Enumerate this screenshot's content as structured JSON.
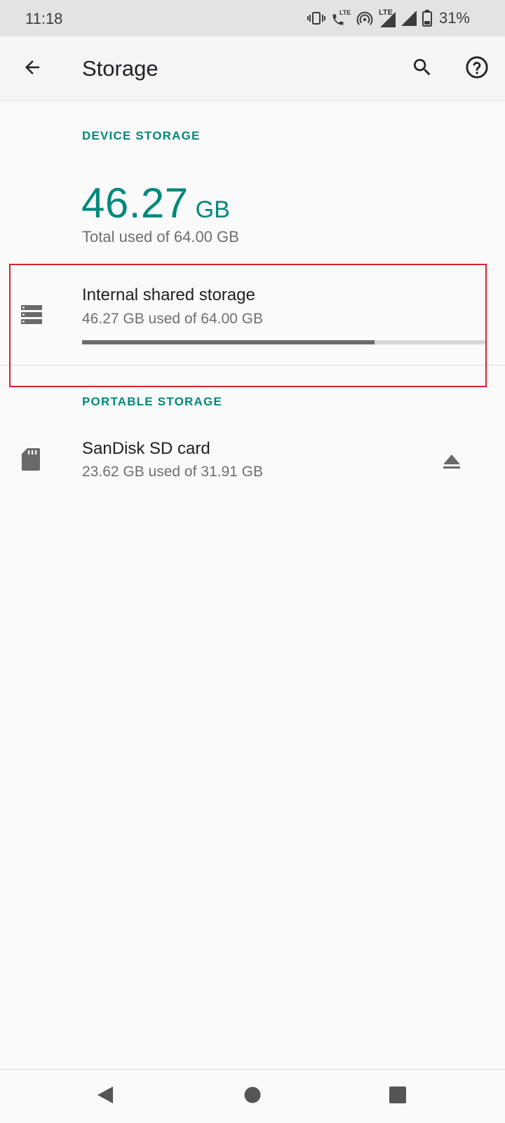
{
  "status_bar": {
    "time": "11:18",
    "lte_call_label": "LTE",
    "network_label": "LTE",
    "battery_percent": "31%"
  },
  "toolbar": {
    "title": "Storage",
    "icons": [
      "arrow-back-icon",
      "search-icon",
      "help-icon"
    ]
  },
  "device_storage": {
    "header": "DEVICE STORAGE",
    "total_value": "46.27",
    "total_unit": "GB",
    "total_caption": "Total used of 64.00 GB",
    "internal": {
      "title": "Internal shared storage",
      "subtitle": "46.27 GB used of 64.00 GB",
      "usage_fraction": 0.723,
      "icon": "storage-list-icon"
    }
  },
  "portable_storage": {
    "header": "PORTABLE STORAGE",
    "sd_card": {
      "title": "SanDisk SD card",
      "subtitle": "23.62 GB used of 31.91 GB",
      "icon": "sd-card-icon",
      "action_icon": "eject-icon"
    }
  },
  "colors": {
    "accent": "#00897b",
    "highlight": "#e0202a",
    "bar_fill": "#6a6a6a",
    "bar_track": "#d6d6d6"
  },
  "nav_bar": {
    "icons": [
      "nav-back-icon",
      "nav-home-icon",
      "nav-recents-icon"
    ]
  }
}
